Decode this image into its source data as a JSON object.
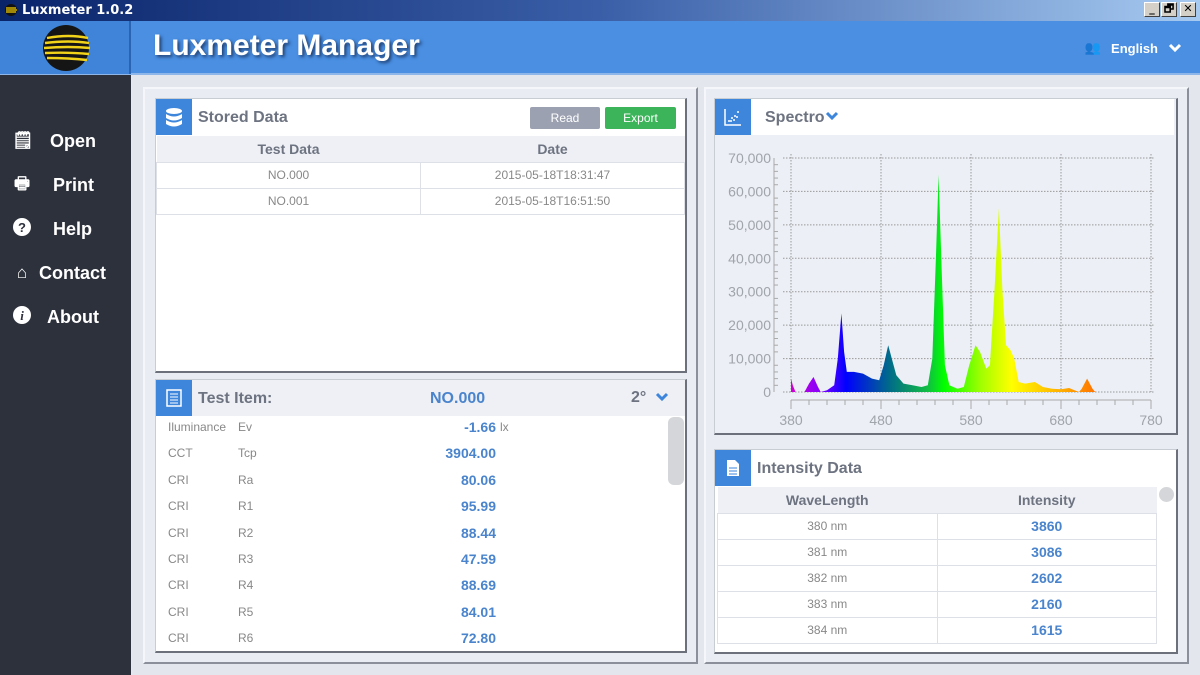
{
  "window": {
    "title": "Luxmeter 1.0.2",
    "controls": [
      "_",
      "🗗",
      "✕"
    ]
  },
  "header": {
    "title": "Luxmeter Manager",
    "language": "English"
  },
  "sidebar": {
    "items": [
      {
        "label": "Open",
        "icon": "document-icon"
      },
      {
        "label": "Print",
        "icon": "printer-icon"
      },
      {
        "label": "Help",
        "icon": "question-icon"
      },
      {
        "label": "Contact",
        "icon": "home-icon"
      },
      {
        "label": "About",
        "icon": "info-icon"
      }
    ]
  },
  "stored": {
    "title": "Stored Data",
    "read_label": "Read",
    "export_label": "Export",
    "columns": [
      "Test Data",
      "Date"
    ],
    "rows": [
      [
        "NO.000",
        "2015-05-18T18:31:47"
      ],
      [
        "NO.001",
        "2015-05-18T16:51:50"
      ]
    ]
  },
  "test_item": {
    "title": "Test Item:",
    "id": "NO.000",
    "angle": "2°",
    "rows": [
      [
        "Iluminance",
        "Ev",
        "-1.66",
        "lx"
      ],
      [
        "CCT",
        "Tcp",
        "3904.00",
        ""
      ],
      [
        "CRI",
        "Ra",
        "80.06",
        ""
      ],
      [
        "CRI",
        "R1",
        "95.99",
        ""
      ],
      [
        "CRI",
        "R2",
        "88.44",
        ""
      ],
      [
        "CRI",
        "R3",
        "47.59",
        ""
      ],
      [
        "CRI",
        "R4",
        "88.69",
        ""
      ],
      [
        "CRI",
        "R5",
        "84.01",
        ""
      ],
      [
        "CRI",
        "R6",
        "72.80",
        ""
      ]
    ]
  },
  "spectro": {
    "title": "Spectro"
  },
  "intensity": {
    "title": "Intensity Data",
    "columns": [
      "WaveLength",
      "Intensity"
    ],
    "rows": [
      [
        "380 nm",
        "3860"
      ],
      [
        "381 nm",
        "3086"
      ],
      [
        "382 nm",
        "2602"
      ],
      [
        "383 nm",
        "2160"
      ],
      [
        "384 nm",
        "1615"
      ]
    ]
  },
  "colors": {
    "accent": "#3d86dc",
    "export": "#3cb55a",
    "read": "#9ba1b0",
    "sidebar": "#2d313c",
    "header": "#4a8fe2"
  },
  "chart_data": {
    "type": "area",
    "xlim": [
      380,
      780
    ],
    "ylim": [
      0,
      70000
    ],
    "grid": true,
    "x_ticks": [
      380,
      480,
      580,
      680,
      780
    ],
    "y_ticks": [
      0,
      10000,
      20000,
      30000,
      40000,
      50000,
      60000,
      70000
    ],
    "y_tick_labels": [
      "0",
      "10,000",
      "20,000",
      "30,000",
      "40,000",
      "50,000",
      "60,000",
      "70,000"
    ],
    "fill": "wavelength-rainbow",
    "points": [
      [
        380,
        4000
      ],
      [
        382,
        2000
      ],
      [
        385,
        0
      ],
      [
        395,
        0
      ],
      [
        400,
        2500
      ],
      [
        405,
        4500
      ],
      [
        410,
        1500
      ],
      [
        413,
        0
      ],
      [
        420,
        500
      ],
      [
        428,
        2000
      ],
      [
        432,
        10000
      ],
      [
        436,
        23500
      ],
      [
        439,
        12000
      ],
      [
        442,
        6000
      ],
      [
        450,
        6000
      ],
      [
        460,
        5500
      ],
      [
        470,
        4000
      ],
      [
        478,
        3500
      ],
      [
        483,
        8000
      ],
      [
        488,
        14000
      ],
      [
        492,
        10000
      ],
      [
        497,
        5000
      ],
      [
        505,
        2500
      ],
      [
        515,
        2000
      ],
      [
        525,
        1500
      ],
      [
        532,
        2000
      ],
      [
        537,
        10000
      ],
      [
        541,
        40000
      ],
      [
        544,
        65000
      ],
      [
        547,
        40000
      ],
      [
        551,
        8000
      ],
      [
        556,
        2000
      ],
      [
        565,
        1000
      ],
      [
        572,
        1500
      ],
      [
        578,
        8000
      ],
      [
        585,
        14000
      ],
      [
        590,
        12000
      ],
      [
        597,
        7000
      ],
      [
        601,
        8000
      ],
      [
        606,
        30000
      ],
      [
        611,
        55000
      ],
      [
        615,
        30000
      ],
      [
        619,
        14000
      ],
      [
        624,
        12500
      ],
      [
        628,
        10000
      ],
      [
        633,
        3000
      ],
      [
        640,
        2500
      ],
      [
        651,
        3000
      ],
      [
        660,
        1500
      ],
      [
        670,
        1000
      ],
      [
        680,
        800
      ],
      [
        689,
        1200
      ],
      [
        695,
        500
      ],
      [
        700,
        0
      ],
      [
        703,
        1000
      ],
      [
        709,
        4000
      ],
      [
        715,
        1000
      ],
      [
        718,
        0
      ],
      [
        780,
        0
      ]
    ]
  }
}
